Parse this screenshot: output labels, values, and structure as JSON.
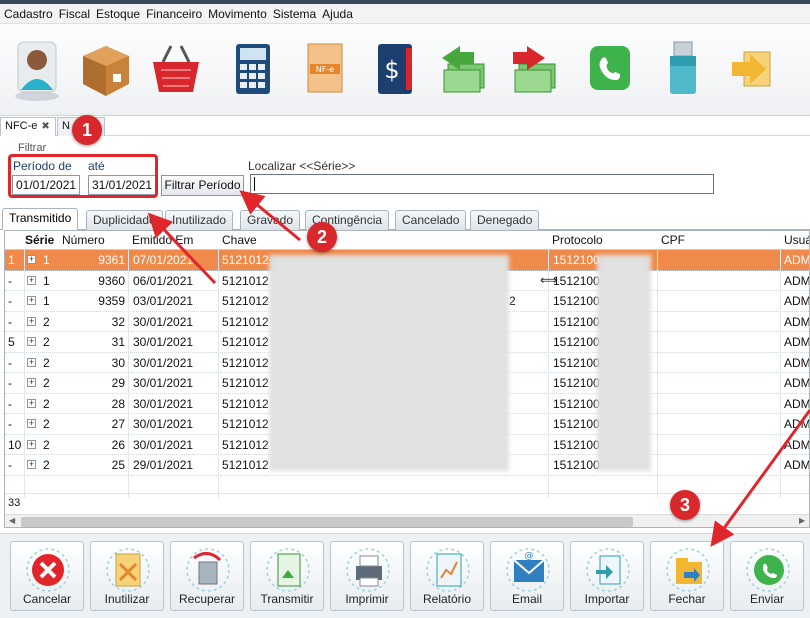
{
  "menu": [
    "Cadastro",
    "Fiscal",
    "Estoque",
    "Financeiro",
    "Movimento",
    "Sistema",
    "Ajuda"
  ],
  "toolbar_icons": [
    "person-icon",
    "box-icon",
    "basket-icon",
    "calculator-icon",
    "nfe-document-icon",
    "cash-book-icon",
    "money-in-icon",
    "money-out-icon",
    "phone-icon",
    "usb-drive-icon",
    "exit-arrow-icon"
  ],
  "doc_tabs": {
    "nfce": "NFC-e",
    "second": "N"
  },
  "filter": {
    "legend": "Filtrar",
    "periodo_label": "Período de",
    "ate_label": "até",
    "date_from": "01/01/2021",
    "date_to": "31/01/2021",
    "button": "Filtrar Período",
    "localizar_label": "Localizar <<Série>>",
    "search_value": ""
  },
  "status_tabs": [
    "Transmitido",
    "Duplicidade",
    "Inutilizado",
    "Gravado",
    "Contingência",
    "Cancelado",
    "Denegado"
  ],
  "grid": {
    "headers": {
      "serie": "Série",
      "numero": "Número",
      "emitido": "Emitido Em",
      "chave": "Chave",
      "protocolo": "Protocolo",
      "cpf": "CPF",
      "usuario": "Usuá"
    },
    "rows": [
      {
        "idx": "1",
        "serie": "1",
        "numero": "9361",
        "emitido": "07/01/2021",
        "chave": "5121012",
        "chave_end": "",
        "protocolo": "1512100",
        "usuario": "ADM"
      },
      {
        "idx": "-",
        "serie": "1",
        "numero": "9360",
        "emitido": "06/01/2021",
        "chave": "5121012",
        "chave_end": "",
        "protocolo": "1512100",
        "usuario": "ADM"
      },
      {
        "idx": "-",
        "serie": "1",
        "numero": "9359",
        "emitido": "03/01/2021",
        "chave": "5121012",
        "chave_end": "2",
        "protocolo": "1512100",
        "usuario": "ADM"
      },
      {
        "idx": "-",
        "serie": "2",
        "numero": "32",
        "emitido": "30/01/2021",
        "chave": "5121012",
        "chave_end": "",
        "protocolo": "1512100",
        "usuario": "ADM"
      },
      {
        "idx": "5",
        "serie": "2",
        "numero": "31",
        "emitido": "30/01/2021",
        "chave": "5121012",
        "chave_end": "",
        "protocolo": "1512100",
        "usuario": "ADM"
      },
      {
        "idx": "-",
        "serie": "2",
        "numero": "30",
        "emitido": "30/01/2021",
        "chave": "5121012",
        "chave_end": "",
        "protocolo": "1512100",
        "usuario": "ADM"
      },
      {
        "idx": "-",
        "serie": "2",
        "numero": "29",
        "emitido": "30/01/2021",
        "chave": "5121012",
        "chave_end": "",
        "protocolo": "1512100",
        "usuario": "ADM"
      },
      {
        "idx": "-",
        "serie": "2",
        "numero": "28",
        "emitido": "30/01/2021",
        "chave": "5121012",
        "chave_end": "",
        "protocolo": "1512100",
        "usuario": "ADM"
      },
      {
        "idx": "-",
        "serie": "2",
        "numero": "27",
        "emitido": "30/01/2021",
        "chave": "5121012",
        "chave_end": "",
        "protocolo": "1512100",
        "usuario": "ADM"
      },
      {
        "idx": "10",
        "serie": "2",
        "numero": "26",
        "emitido": "30/01/2021",
        "chave": "5121012",
        "chave_end": "",
        "protocolo": "1512100",
        "usuario": "ADM"
      },
      {
        "idx": "-",
        "serie": "2",
        "numero": "25",
        "emitido": "29/01/2021",
        "chave": "5121012",
        "chave_end": "",
        "protocolo": "1512100",
        "usuario": "ADM"
      }
    ],
    "footer_count": "33"
  },
  "actions": [
    {
      "label": "Cancelar",
      "icon": "cancel-icon"
    },
    {
      "label": "Inutilizar",
      "icon": "void-document-icon"
    },
    {
      "label": "Recuperar",
      "icon": "recover-trash-icon"
    },
    {
      "label": "Transmitir",
      "icon": "transmit-document-icon"
    },
    {
      "label": "Imprimir",
      "icon": "printer-icon"
    },
    {
      "label": "Relatório",
      "icon": "report-icon"
    },
    {
      "label": "Email",
      "icon": "email-icon"
    },
    {
      "label": "Importar",
      "icon": "import-icon"
    },
    {
      "label": "Fechar",
      "icon": "close-folder-icon"
    },
    {
      "label": "Enviar",
      "icon": "whatsapp-icon"
    }
  ],
  "callouts": [
    "1",
    "2",
    "3"
  ],
  "colors": {
    "selected_row": "#f08a4b",
    "highlight": "#e0252b"
  }
}
